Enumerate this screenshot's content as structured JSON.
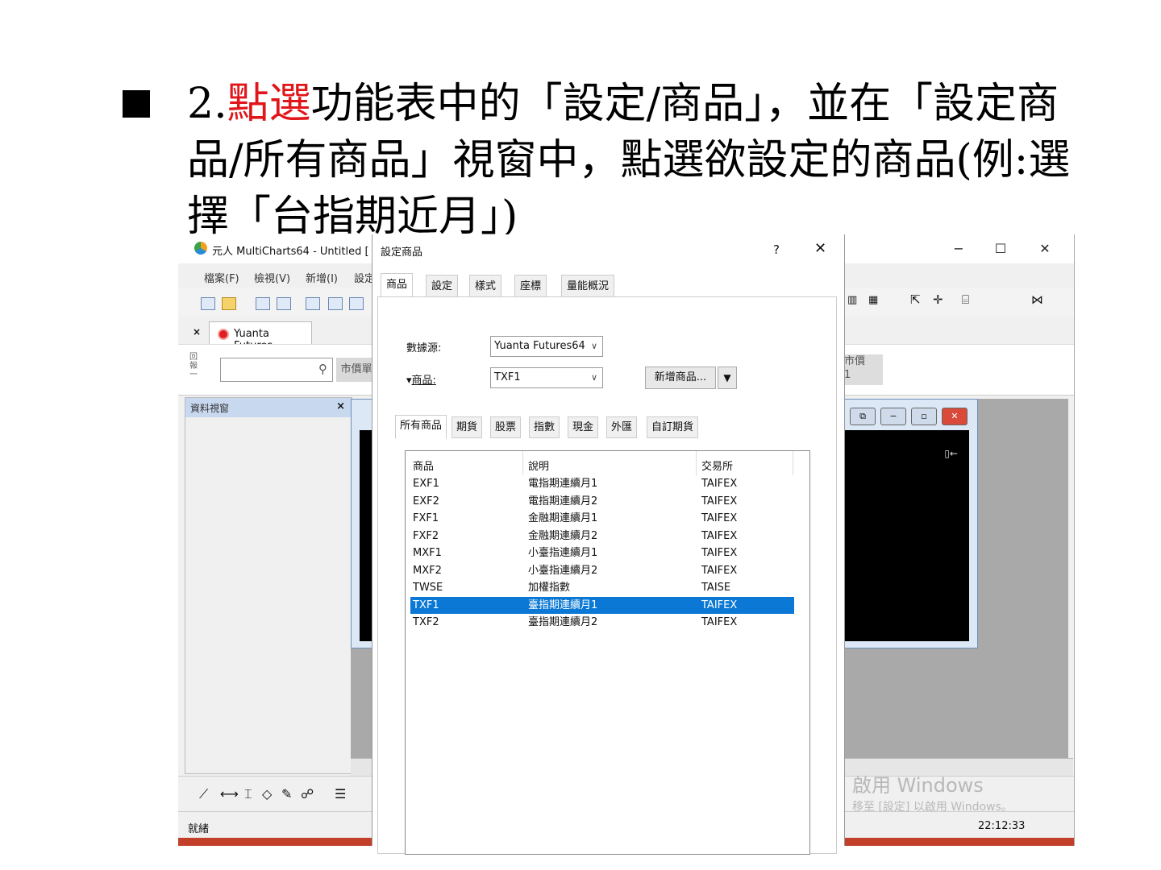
{
  "slide": {
    "num": "2.",
    "highlight": "點選",
    "rest": "功能表中的「設定/商品」，並在「設定商品/所有商品」視窗中，點選欲設定的商品(例:選擇「台指期近月」)",
    "highlight_color": "#e0161b"
  },
  "app": {
    "title": "元人 MultiCharts64 - Untitled [",
    "menu": [
      "檔案(F)",
      "檢視(V)",
      "新增(I)",
      "設定"
    ],
    "doc_tab": "Yuanta Futures",
    "side_label": "回報一",
    "market_btn": "市價單",
    "right_market_1": "市價",
    "right_market_2": "1",
    "data_panel_title": "資料視窗",
    "data_panel_close": "×",
    "tab_close": "×",
    "status": "就緒",
    "clock": "22:12:33",
    "activate_line1": "啟用 Windows",
    "activate_line2": "移至 [設定] 以啟用 Windows。",
    "min_glyph": "−",
    "max_glyph": "☐",
    "close_glyph": "✕"
  },
  "dialog": {
    "title": "設定商品",
    "help": "?",
    "close": "✕",
    "tabs": [
      "商品",
      "設定",
      "樣式",
      "座標",
      "量能概況"
    ],
    "datasource_label": "數據源:",
    "datasource_value": "Yuanta Futures64",
    "symbol_label": "商品:",
    "symbol_value": "TXF1",
    "add_button": "新增商品...",
    "add_dropdown": "▼",
    "category_tabs": [
      "所有商品",
      "期貨",
      "股票",
      "指數",
      "現金",
      "外匯",
      "自訂期貨"
    ],
    "columns": [
      "商品",
      "說明",
      "交易所"
    ],
    "rows": [
      {
        "symbol": "EXF1",
        "desc": "電指期連續月1",
        "exchange": "TAIFEX"
      },
      {
        "symbol": "EXF2",
        "desc": "電指期連續月2",
        "exchange": "TAIFEX"
      },
      {
        "symbol": "FXF1",
        "desc": "金融期連續月1",
        "exchange": "TAIFEX"
      },
      {
        "symbol": "FXF2",
        "desc": "金融期連續月2",
        "exchange": "TAIFEX"
      },
      {
        "symbol": "MXF1",
        "desc": "小臺指連續月1",
        "exchange": "TAIFEX"
      },
      {
        "symbol": "MXF2",
        "desc": "小臺指連續月2",
        "exchange": "TAIFEX"
      },
      {
        "symbol": "TWSE",
        "desc": "加權指數",
        "exchange": "TAISE"
      },
      {
        "symbol": "TXF1",
        "desc": "臺指期連續月1",
        "exchange": "TAIFEX",
        "selected": true
      },
      {
        "symbol": "TXF2",
        "desc": "臺指期連續月2",
        "exchange": "TAIFEX"
      }
    ],
    "selection_color": "#0a78d4"
  },
  "icons": {
    "search": "search-icon",
    "logo": "app-logo-icon",
    "dropdown": "chevron-down-icon"
  }
}
